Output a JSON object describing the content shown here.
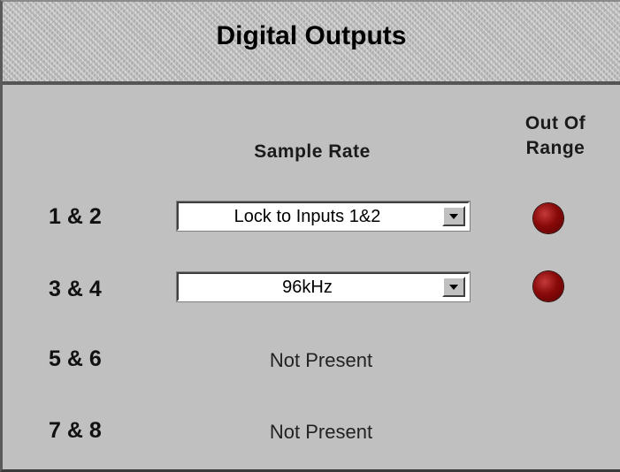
{
  "header": {
    "title": "Digital Outputs"
  },
  "columns": {
    "sample_rate": "Sample Rate",
    "out_of_range_line1": "Out Of",
    "out_of_range_line2": "Range"
  },
  "rows": [
    {
      "label": "1 & 2",
      "sample_rate": "Lock to Inputs 1&2",
      "led_color": "#8a0a0a"
    },
    {
      "label": "3 & 4",
      "sample_rate": "96kHz",
      "led_color": "#8a0a0a"
    },
    {
      "label": "5 & 6",
      "status": "Not Present"
    },
    {
      "label": "7 & 8",
      "status": "Not Present"
    }
  ],
  "icons": {
    "dropdown": "chevron-down-icon",
    "indicator": "red-led-icon"
  },
  "colors": {
    "panel_bg": "#c0c0c0",
    "led_red": "#8a0a0a"
  }
}
